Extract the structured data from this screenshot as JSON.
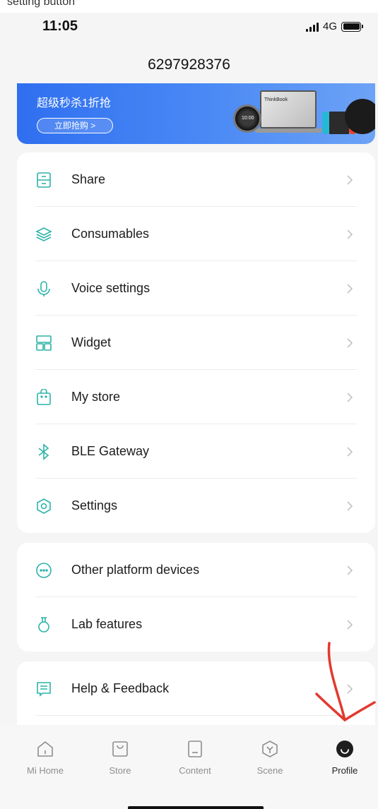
{
  "top_strip_text": "setting button",
  "status_bar": {
    "time": "11:05",
    "network": "4G"
  },
  "header": {
    "account_id": "6297928376"
  },
  "banner": {
    "title": "超级秒杀1折抢",
    "button_label": "立即抢购 >",
    "laptop_brand": "ThinkBook",
    "watch_time": "10:00"
  },
  "menu_group_1": [
    {
      "label": "Share",
      "icon": "share-icon"
    },
    {
      "label": "Consumables",
      "icon": "layers-icon"
    },
    {
      "label": "Voice settings",
      "icon": "microphone-icon"
    },
    {
      "label": "Widget",
      "icon": "widget-icon"
    },
    {
      "label": "My store",
      "icon": "shopping-bag-icon"
    },
    {
      "label": "BLE Gateway",
      "icon": "bluetooth-icon"
    },
    {
      "label": "Settings",
      "icon": "settings-icon"
    }
  ],
  "menu_group_2": [
    {
      "label": "Other platform devices",
      "icon": "more-circle-icon"
    },
    {
      "label": "Lab features",
      "icon": "flask-icon"
    }
  ],
  "menu_group_3": [
    {
      "label": "Help & Feedback",
      "icon": "feedback-icon"
    }
  ],
  "tab_bar": {
    "tabs": [
      {
        "label": "Mi Home",
        "icon": "home-icon"
      },
      {
        "label": "Store",
        "icon": "store-icon"
      },
      {
        "label": "Content",
        "icon": "content-icon"
      },
      {
        "label": "Scene",
        "icon": "scene-icon"
      },
      {
        "label": "Profile",
        "icon": "profile-icon"
      }
    ],
    "active": "Profile"
  },
  "colors": {
    "accent_teal": "#2bb3a8",
    "annotation_red": "#e2392f",
    "banner_blue": "#3b7cf2"
  }
}
